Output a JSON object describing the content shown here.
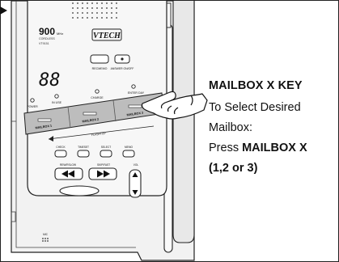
{
  "device": {
    "brand": "VTECH",
    "freq_value": "900",
    "freq_unit": "MHz",
    "freq_sub": "CORDLESS",
    "model": "VT9151",
    "display_digits": "88",
    "top_buttons": [
      "RECMEMO",
      "ANSWER ON/OFF"
    ],
    "indicators": [
      "POWER",
      "IN USE",
      "CHARGE",
      "ENTER DAY"
    ],
    "mailbox_keys": [
      "MAILBOX 1",
      "MAILBOX 2",
      "MAILBOX 3"
    ],
    "flash_label": "FLASHTOP",
    "control_row": [
      "CHECK",
      "TIMESET",
      "SELECT",
      "MEMO"
    ],
    "transport_labels": [
      "REW/RSLOW",
      "SKIP/FAST",
      "VOL"
    ],
    "page_label": "PAGE",
    "mic_label": "MIC"
  },
  "callout": {
    "heading": "MAILBOX X KEY",
    "line1": "To Select Desired",
    "line2": "Mailbox:",
    "line3_prefix": "Press ",
    "line3_bold": "MAILBOX X",
    "line4": "(1,2 or 3)"
  }
}
